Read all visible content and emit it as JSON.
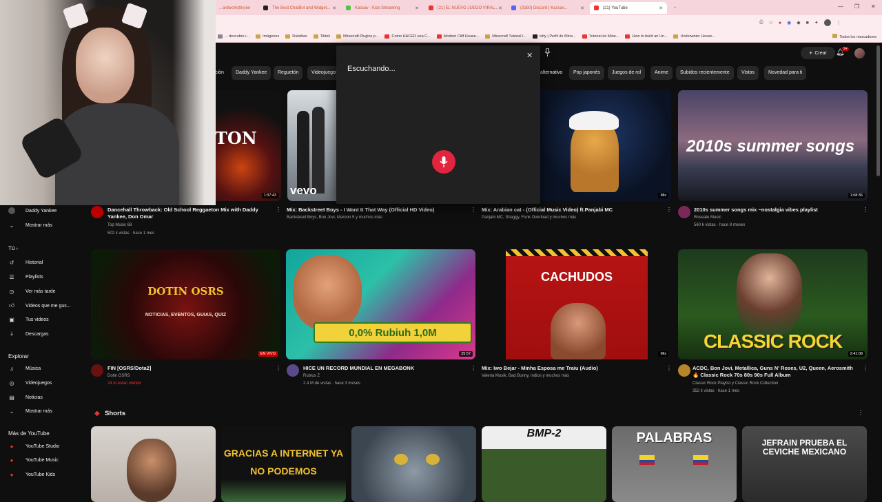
{
  "browser": {
    "tabs": [
      {
        "label": "...ardwork(ttrv)en",
        "color": "#e44"
      },
      {
        "label": "The Best ChatBot and Widget...",
        "color": "#222"
      },
      {
        "label": "Kassav - Kick Streaming",
        "color": "#53c248"
      },
      {
        "label": "[21] EL NUEVO JUEGO VIRAL...",
        "color": "#e33"
      },
      {
        "label": "(3160) Discord | Kassav...",
        "color": "#5865f2"
      },
      {
        "label": "(21) YouTube",
        "color": "#e33"
      }
    ],
    "bookmarks": [
      "... descubre i...",
      "Imágenes",
      "Ruletitas",
      "Tiktok",
      "Minecraft Plugins p...",
      "Como HACER una C...",
      "Modern Cliff House...",
      "Minecraft Tutorial I...",
      "kitty | Perfil de Mine...",
      "Tutorial de Mine...",
      "How to build an Un...",
      "Underwater House..."
    ],
    "all_bookmarks": "Todos los marcadores"
  },
  "header": {
    "create_label": "Crear",
    "notif_count": "9+"
  },
  "chips": [
    {
      "label": "ción"
    },
    {
      "label": "Daddy Yankee"
    },
    {
      "label": "Reguetón"
    },
    {
      "label": "Videojuegos"
    },
    {
      "label": "alternativo"
    },
    {
      "label": "Pop japonés"
    },
    {
      "label": "Juegos de rol"
    },
    {
      "label": "Anime"
    },
    {
      "label": "Subidos recientemente"
    },
    {
      "label": "Vistos"
    },
    {
      "label": "Novedad para ti"
    }
  ],
  "voice_dialog": {
    "status": "Escuchando..."
  },
  "sidebar": {
    "sub_daddy": "Daddy Yankee",
    "show_more": "Mostrar más",
    "you_label": "Tú",
    "you_items": [
      "Historial",
      "Playlists",
      "Ver más tarde",
      "Videos que me gus...",
      "Tus videos",
      "Descargas"
    ],
    "explore_label": "Explorar",
    "explore_items": [
      "Música",
      "Videojuegos",
      "Noticias",
      "Mostrar más"
    ],
    "more_yt_label": "Más de YouTube",
    "more_yt_items": [
      "YouTube Studio",
      "YouTube Music",
      "YouTube Kids"
    ]
  },
  "videos_row1": [
    {
      "title": "Dancehall Throwback: Old School Reggaeton Mix with Daddy Yankee, Don Omar",
      "channel": "Top Music 68",
      "stats": "502 k vistas · hace 1 mes",
      "duration": "1:37:43"
    },
    {
      "title": "Mix: Backstreet Boys - I Want It That Way (Official HD Video)",
      "channel": "Backstreet Boys, Bon Jovi, Maroon 5 y muchos más",
      "stats": "",
      "duration": ""
    },
    {
      "title": "Mix: Arabian cat - (Official Music Video) ft.Panjabi MC",
      "channel": "Panjabi MC, Shaggy, Funk Overload y muchos más",
      "stats": "",
      "duration": "Mix"
    },
    {
      "title": "2010s summer songs mix ~nostalgia vibes playlist",
      "channel": "Roseate Music",
      "stats": "560 k vistas · hace 8 meses",
      "duration": "1:08:36",
      "thumb_text": "2010s summer songs"
    }
  ],
  "videos_row2": [
    {
      "title": "FIN [OSRS/Dota2]",
      "channel": "Dotin OSRS",
      "stats": "24 lo están viendo",
      "duration": "EN VIVO",
      "thumb_text": "DOTIN OSRS",
      "thumb_sub": "NOTICIAS, EVENTOS, GUIAS, QUIZ"
    },
    {
      "title": "HICE UN RECORD MUNDIAL EN MEGABONK",
      "channel": "Rubius Z",
      "stats": "2.4 M de vistas · hace 3 meses",
      "duration": "25:57",
      "thumb_text": "0,0% Rubiuh 1,0M"
    },
    {
      "title": "Mix: Iwo Bejar - Minha Esposa me Traiu (Audio)",
      "channel": "Valeria Musik, Bad Bunny, indios y muchos más",
      "stats": "",
      "duration": "Mix",
      "thumb_text": "CACHUDOS"
    },
    {
      "title": "ACDC, Bon Jovi, Metallica, Guns N' Roses, U2, Queen, Aerosmith 🔥 Classic Rock 70s 80s 90s Full Album",
      "channel": "Classic Rock Playlist y Classic Rock Collection",
      "stats": "352 k vistas · hace 1 mes",
      "duration": "2:41:08",
      "thumb_text": "CLASSIC ROCK"
    }
  ],
  "shorts": {
    "label": "Shorts",
    "texts": [
      "",
      "GRACIAS A INTERNET YA NO PODEMOS",
      "",
      "BMP-2",
      "PALABRAS",
      "JEFRAIN PRUEBA EL CEVICHE MEXICANO"
    ]
  }
}
